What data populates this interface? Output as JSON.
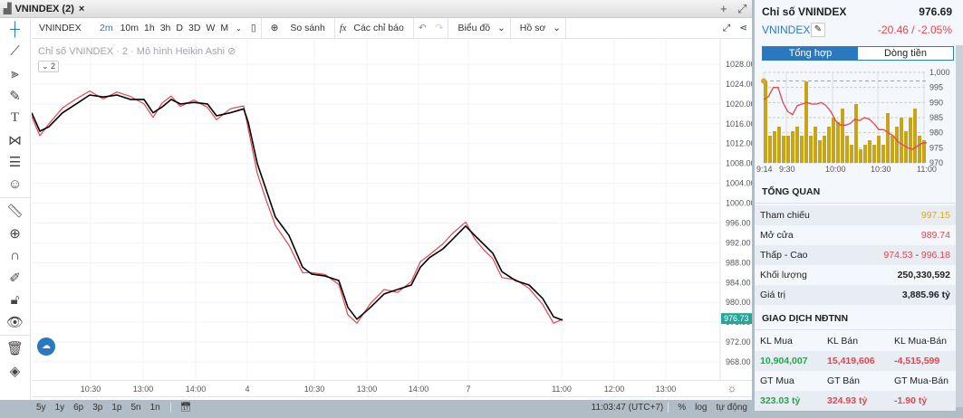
{
  "tab": {
    "title": "VNINDEX (2)",
    "close": "×",
    "add": "+",
    "expand": "⤢"
  },
  "toolbar": {
    "symbol": "VNINDEX",
    "intervals": [
      "2m",
      "10m",
      "1h",
      "3h",
      "D",
      "3D",
      "W",
      "M"
    ],
    "active_interval": "2m",
    "compare": "So sánh",
    "indicators": "Các chỉ báo",
    "chart_type": "Biểu đồ",
    "profile": "Hồ sơ"
  },
  "legend": {
    "title": "Chỉ số VNINDEX · 2 · Mô hình Heikin Ashi",
    "collapse": "2"
  },
  "time_labels": [
    "10:30",
    "13:00",
    "14:00",
    "4",
    "10:30",
    "13:00",
    "14:00",
    "7",
    "11:00",
    "12:00",
    "13:00"
  ],
  "bottom": {
    "ranges": [
      "5y",
      "1y",
      "6p",
      "3p",
      "1p",
      "5n",
      "1n"
    ],
    "clock": "11:03:47 (UTC+7)",
    "percent": "%",
    "log": "log",
    "auto": "tự động"
  },
  "colors": {
    "accent": "#2a78c0",
    "down": "#e8434b",
    "up": "#1ea84a",
    "ref": "#d4a72c"
  },
  "chart_data": {
    "type": "line",
    "title": "Chỉ số VNINDEX · 2 · Mô hình Heikin Ashi",
    "ylim": [
      966,
      1030
    ],
    "yticks": [
      968,
      972,
      976,
      980,
      984,
      988,
      992,
      996,
      1000,
      1004,
      1008,
      1012,
      1016,
      1020,
      1024,
      1028
    ],
    "last_value": "976.73",
    "x": [
      0,
      9,
      19,
      34,
      49,
      64,
      79,
      94,
      109,
      124,
      134,
      144,
      154,
      164,
      179,
      194,
      204,
      219,
      234,
      239,
      249,
      259,
      269,
      284,
      299,
      309,
      324,
      339,
      349,
      359,
      374,
      389,
      404,
      419,
      429,
      439,
      454,
      464,
      479,
      489,
      499,
      509,
      519,
      534,
      549,
      564,
      576,
      586
    ],
    "series": [
      {
        "name": "close",
        "color": "#000000",
        "values": [
          1018.2,
          1014.5,
          1015.4,
          1018.2,
          1020,
          1021.8,
          1021.4,
          1021.8,
          1020.9,
          1020.9,
          1018.2,
          1019.4,
          1020.9,
          1020,
          1020.3,
          1020,
          1017.6,
          1018.2,
          1019,
          1016.3,
          1008,
          1002.6,
          997.2,
          993.5,
          987.1,
          985.7,
          985.3,
          984.4,
          979,
          976.6,
          979,
          981.7,
          982.6,
          983.5,
          987.1,
          989,
          990.8,
          992.6,
          995.4,
          993.5,
          991.7,
          989.9,
          986.2,
          984.4,
          983.5,
          980.8,
          977.1,
          976.4
        ]
      },
      {
        "name": "heikin-ashi",
        "color": "#e8434b",
        "values": [
          1017.5,
          1013.6,
          1016,
          1019.2,
          1021,
          1022.6,
          1021,
          1022.4,
          1021.5,
          1020,
          1017.3,
          1020.2,
          1021.6,
          1019.5,
          1020.8,
          1019.3,
          1016.8,
          1019,
          1019.6,
          1015,
          1006,
          1000.5,
          995.5,
          991.5,
          986,
          986,
          985.6,
          983.6,
          977.5,
          975.8,
          979.8,
          982.6,
          982,
          984.2,
          988.2,
          989.6,
          991.8,
          993.8,
          996.2,
          992.8,
          990.6,
          988.8,
          985,
          984.6,
          982.8,
          979.6,
          975.8,
          976.6
        ]
      }
    ]
  },
  "mini_chart": {
    "ylim": [
      970,
      1000
    ],
    "yticks": [
      "1,000",
      "995",
      "990",
      "985",
      "980",
      "975",
      "970"
    ],
    "xticks": [
      "9:14",
      "9:30",
      "10:00",
      "10:30",
      "11:00"
    ],
    "ref": 997.15,
    "price": [
      991,
      992,
      995,
      995,
      990,
      987,
      986,
      989,
      989.5,
      990,
      989.5,
      989.5,
      990,
      989,
      987,
      984,
      982.5,
      982.5,
      983,
      984.5,
      984,
      985,
      984.5,
      983,
      981,
      981,
      980,
      979,
      977,
      976,
      975,
      974.5,
      975.5,
      976.5,
      976.7
    ],
    "volume": [
      0.9,
      0.3,
      0.35,
      0.4,
      0.3,
      0.3,
      0.35,
      0.4,
      0.3,
      0.9,
      0.3,
      0.4,
      0.25,
      0.3,
      0.4,
      0.5,
      0.45,
      0.6,
      0.3,
      0.2,
      0.65,
      0.15,
      0.2,
      0.25,
      0.2,
      0.3,
      0.2,
      0.55,
      0.3,
      0.4,
      0.5,
      0.35,
      0.5,
      0.6,
      0.3,
      0.25
    ]
  },
  "panel": {
    "title": "Chỉ số VNINDEX",
    "price": "976.69",
    "symbol": "VNINDEX",
    "change": "-20.46 / -2.05%",
    "tabs": [
      "Tổng hợp",
      "Dòng tiền"
    ],
    "overview_title": "TỔNG QUAN",
    "rows": [
      {
        "label": "Tham chiếu",
        "value": "997.15"
      },
      {
        "label": "Mở cửa",
        "value": "989.74"
      },
      {
        "label": "Thấp - Cao",
        "low": "974.53",
        "sep": "-",
        "high": "996.18"
      },
      {
        "label": "Khối lượng",
        "value": "250,330,592"
      },
      {
        "label": "Giá trị",
        "value": "3,885.96 tỷ"
      }
    ],
    "foreign_title": "GIAO DỊCH NĐTNN",
    "foreign": {
      "h1": [
        "KL Mua",
        "KL Bán",
        "KL Mua-Bán"
      ],
      "v1": [
        "10,904,007",
        "15,419,606",
        "-4,515,599"
      ],
      "h2": [
        "GT Mua",
        "GT Bán",
        "GT Mua-Bán"
      ],
      "v2": [
        "323.03 tỷ",
        "324.93 tỷ",
        "-1.90 tỷ"
      ]
    }
  }
}
